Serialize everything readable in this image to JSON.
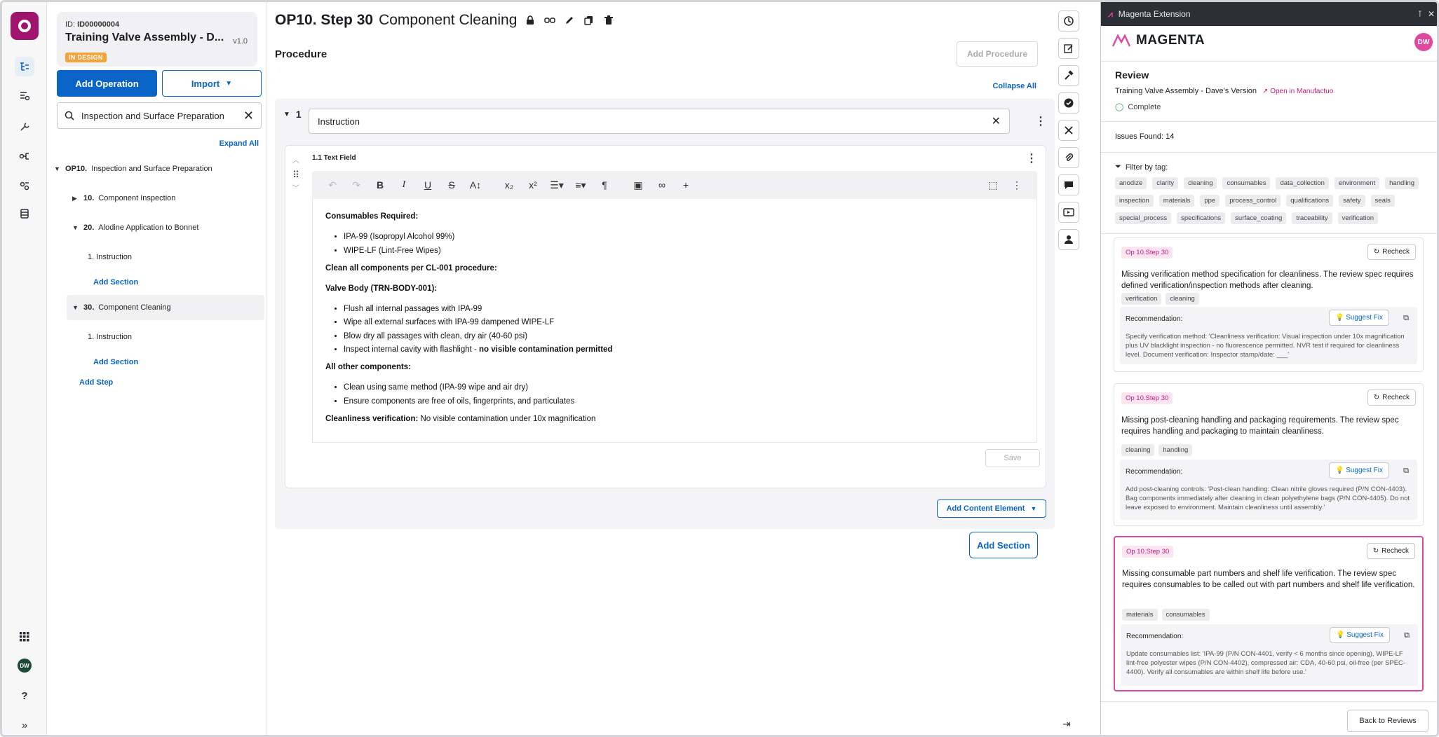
{
  "tree": {
    "id_label": "ID:",
    "id_value": "ID00000004",
    "title": "Training Valve Assembly - D...",
    "version": "v1.0",
    "status_badge": "IN DESIGN",
    "add_operation": "Add Operation",
    "import_label": "Import",
    "search_value": "Inspection and Surface Preparation",
    "expand_all": "Expand All",
    "operation": {
      "num": "OP10.",
      "name": "Inspection and Surface Preparation"
    },
    "steps": [
      {
        "num": "10.",
        "name": "Component Inspection"
      },
      {
        "num": "20.",
        "name": "Alodine Application to Bonnet",
        "child": "1. Instruction",
        "add_section": "Add Section"
      },
      {
        "num": "30.",
        "name": "Component Cleaning",
        "child": "1. Instruction",
        "add_section": "Add Section"
      }
    ],
    "add_step": "Add Step"
  },
  "main": {
    "title_bold": "OP10. Step 30",
    "title_rest": "Component Cleaning",
    "procedure": "Procedure",
    "add_procedure": "Add Procedure",
    "collapse_all": "Collapse All",
    "section_num": "1",
    "section_value": "Instruction",
    "field_label": "1.1 Text Field",
    "save": "Save",
    "add_content_element": "Add Content Element",
    "add_section": "Add Section",
    "content": {
      "h1": "Consumables Required:",
      "l1": [
        "IPA-99 (Isopropyl Alcohol 99%)",
        "WIPE-LF (Lint-Free Wipes)"
      ],
      "h2": "Clean all components per CL-001 procedure:",
      "h3": "Valve Body (TRN-BODY-001):",
      "l3": [
        "Flush all internal passages with IPA-99",
        "Wipe all external surfaces with IPA-99 dampened WIPE-LF",
        "Blow dry all passages with clean, dry air (40-60 psi)"
      ],
      "l3_last_pre": "Inspect internal cavity with flashlight - ",
      "l3_last_bold": "no visible contamination permitted",
      "h4": "All other components:",
      "l4": [
        "Clean using same method (IPA-99 wipe and air dry)",
        "Ensure components are free of oils, fingerprints, and particulates"
      ],
      "final_bold": "Cleanliness verification:",
      "final_rest": " No visible contamination under 10x magnification"
    }
  },
  "extension": {
    "window_title": "Magenta Extension",
    "brand": "MAGENTA",
    "user_initials": "DW",
    "review_title": "Review",
    "review_sub": "Training Valve Assembly - Dave's Version",
    "open_link": "Open in Manufactuo",
    "status": "Complete",
    "issues_found": "Issues Found: 14",
    "filter_label": "Filter by tag:",
    "tags": [
      "anodize",
      "clarity",
      "cleaning",
      "consumables",
      "data_collection",
      "environment",
      "handling",
      "inspection",
      "materials",
      "ppe",
      "process_control",
      "qualifications",
      "safety",
      "seals",
      "special_process",
      "specifications",
      "surface_coating",
      "traceability",
      "verification"
    ],
    "recheck": "Recheck",
    "recommendation": "Recommendation:",
    "suggest_fix": "Suggest Fix",
    "issues": [
      {
        "op": "Op 10.Step 30",
        "desc": "Missing verification method specification for cleanliness. The review spec requires defined verification/inspection methods after cleaning.",
        "tags": [
          "verification",
          "cleaning"
        ],
        "rec": "Specify verification method: 'Cleanliness verification: Visual inspection under 10x magnification plus UV blacklight inspection - no fluorescence permitted. NVR test if required for cleanliness level. Document verification: Inspector stamp/date: ___'"
      },
      {
        "op": "Op 10.Step 30",
        "desc": "Missing post-cleaning handling and packaging requirements. The review spec requires handling and packaging to maintain cleanliness.",
        "tags": [
          "cleaning",
          "handling"
        ],
        "rec": "Add post-cleaning controls: 'Post-clean handling: Clean nitrile gloves required (P/N CON-4403). Bag components immediately after cleaning in clean polyethylene bags (P/N CON-4405). Do not leave exposed to environment. Maintain cleanliness until assembly.'"
      },
      {
        "op": "Op 10.Step 30",
        "desc": "Missing consumable part numbers and shelf life verification. The review spec requires consumables to be called out with part numbers and shelf life verification.",
        "tags": [
          "materials",
          "consumables"
        ],
        "rec": "Update consumables list: 'IPA-99 (P/N CON-4401, verify < 6 months since opening), WIPE-LF lint-free polyester wipes (P/N CON-4402), compressed air: CDA, 40-60 psi, oil-free (per SPEC-4400). Verify all consumables are within shelf life before use.'"
      }
    ],
    "back": "Back to Reviews"
  },
  "colors": {
    "brand": "#a0146e",
    "accent": "#0a64c7",
    "magenta": "#e0479e",
    "badge": "#f3a33a"
  }
}
